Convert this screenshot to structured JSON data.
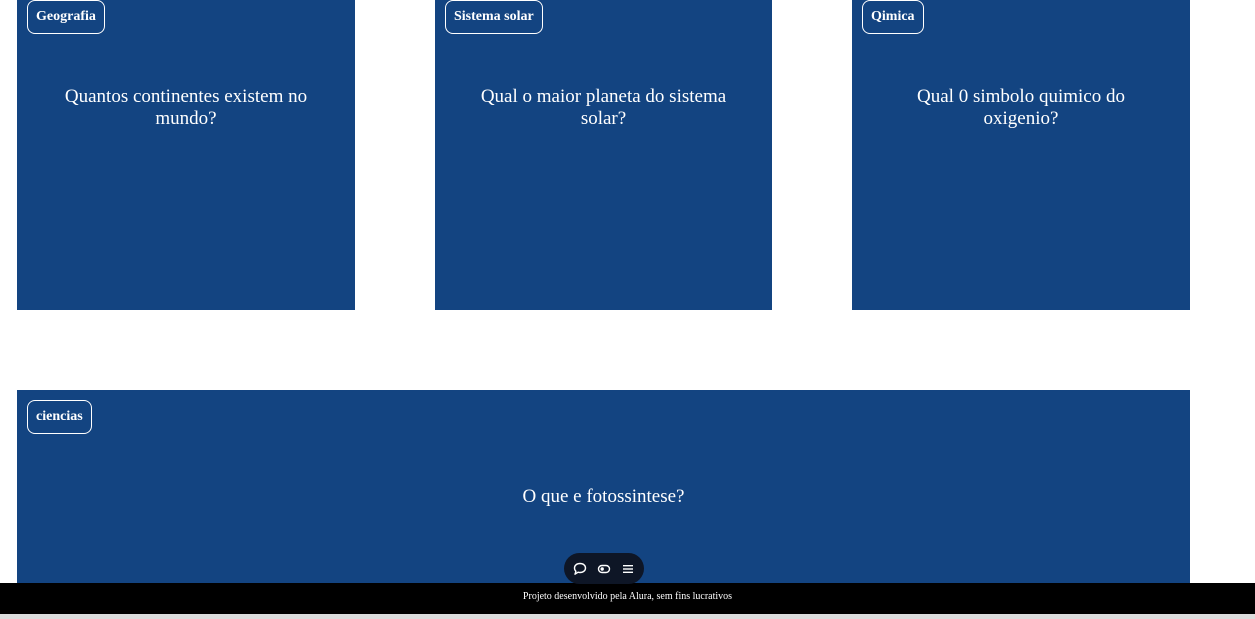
{
  "cards": [
    {
      "tag": "Geografia",
      "question": "Quantos continentes existem no mundo?"
    },
    {
      "tag": "Sistema solar",
      "question": "Qual o maior planeta do sistema solar?"
    },
    {
      "tag": "Qimica",
      "question": "Qual 0 simbolo quimico do oxigenio?"
    },
    {
      "tag": "ciencias",
      "question": "O que e fotossintese?"
    }
  ],
  "toolbar": {
    "icons": [
      "comment-icon",
      "toggle-icon",
      "menu-icon"
    ]
  },
  "footer": {
    "text": "Projeto desenvolvido pela Alura, sem fins lucrativos"
  },
  "colors": {
    "card_background": "#134481",
    "toolbar_background": "#0e1626",
    "footer_background": "#000000"
  }
}
